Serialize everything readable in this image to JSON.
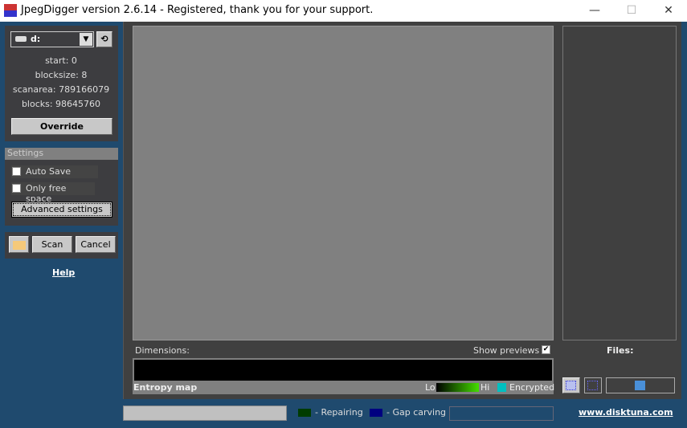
{
  "window": {
    "title": "JpegDigger version 2.6.14 - Registered, thank you for your support.",
    "minimize": "—",
    "maximize": "☐",
    "close": "✕"
  },
  "drive": {
    "selected": "d:",
    "start": "start: 0",
    "blocksize": "blocksize: 8",
    "scanarea": "scanarea: 789166079",
    "blocks": "blocks: 98645760",
    "override": "Override"
  },
  "settings": {
    "title": "Settings",
    "auto_save": "Auto Save",
    "auto_save_checked": false,
    "only_free_space": "Only free space",
    "only_free_space_checked": false,
    "advanced": "Advanced settings"
  },
  "actions": {
    "scan": "Scan",
    "cancel": "Cancel",
    "help": "Help"
  },
  "main": {
    "dimensions": "Dimensions:",
    "show_previews": "Show previews",
    "show_previews_checked": true,
    "entropy_map": "Entropy map",
    "lo": "Lo",
    "hi": "Hi",
    "encrypted": "Encrypted",
    "encrypted_color": "#00c0c0"
  },
  "files": {
    "label": "Files:"
  },
  "status": {
    "repairing": "- Repairing",
    "repairing_color": "#003c00",
    "gap_carving": "- Gap carving",
    "gap_carving_color": "#000080",
    "website": "www.disktuna.com"
  }
}
